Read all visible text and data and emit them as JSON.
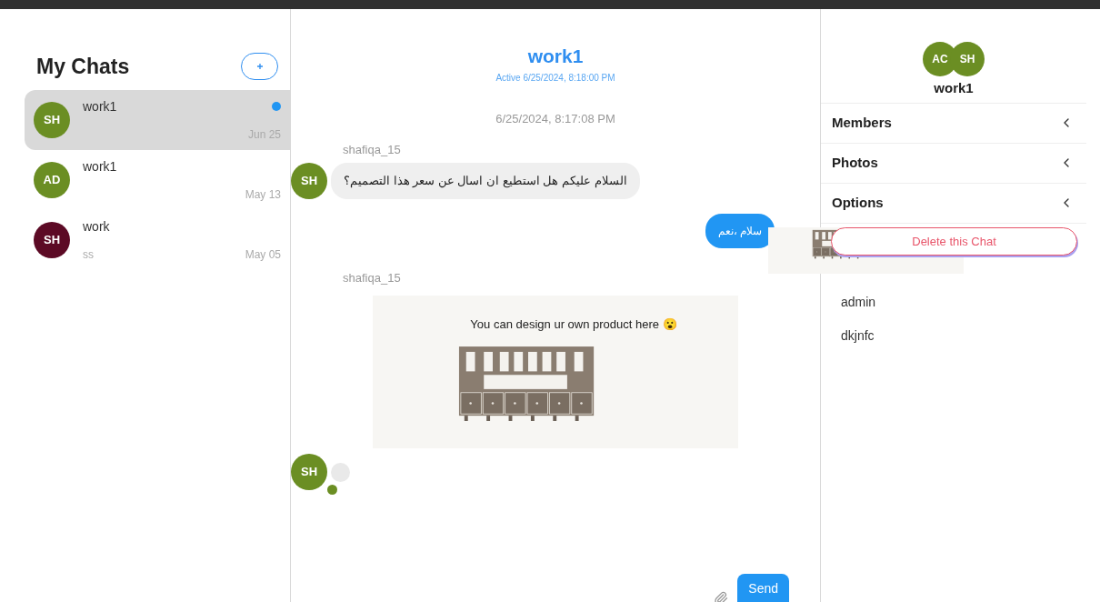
{
  "sidebar": {
    "title": "My Chats",
    "chats": [
      {
        "initials": "SH",
        "color": "#6b8e23",
        "name": "work1",
        "date": "Jun 25",
        "unread": true,
        "selected": true
      },
      {
        "initials": "AD",
        "color": "#6b8e23",
        "name": "work1",
        "date": "May 13",
        "unread": false,
        "selected": false
      },
      {
        "initials": "SH",
        "color": "#5c0a25",
        "name": "work",
        "preview": "ss",
        "date": "May 05",
        "unread": false,
        "selected": false
      }
    ]
  },
  "header": {
    "title": "work1",
    "status": "Active 6/25/2024, 8:18:00 PM"
  },
  "messages": [
    {
      "kind": "timestamp",
      "text": "6/25/2024, 8:17:08 PM"
    },
    {
      "kind": "sender",
      "text": "shafiqa_15"
    },
    {
      "kind": "incoming",
      "initials": "SH",
      "color": "#6b8e23",
      "text": "السلام عليكم هل استطيع ان اسال عن سعر هذا التصميم؟"
    },
    {
      "kind": "outgoing",
      "text": "سلام ،نعم"
    },
    {
      "kind": "sender",
      "text": "shafiqa_15"
    },
    {
      "kind": "image",
      "caption": "You can design ur own product here 😮"
    },
    {
      "kind": "typing",
      "initials": "SH",
      "color": "#6b8e23"
    }
  ],
  "composer": {
    "button": "Send"
  },
  "details": {
    "avatars": [
      "AC",
      "SH"
    ],
    "title": "work1",
    "sections": [
      "Members",
      "Photos",
      "Options"
    ],
    "delete_button": "Delete this Chat",
    "members": [
      "admin",
      "dkjnfc"
    ]
  }
}
